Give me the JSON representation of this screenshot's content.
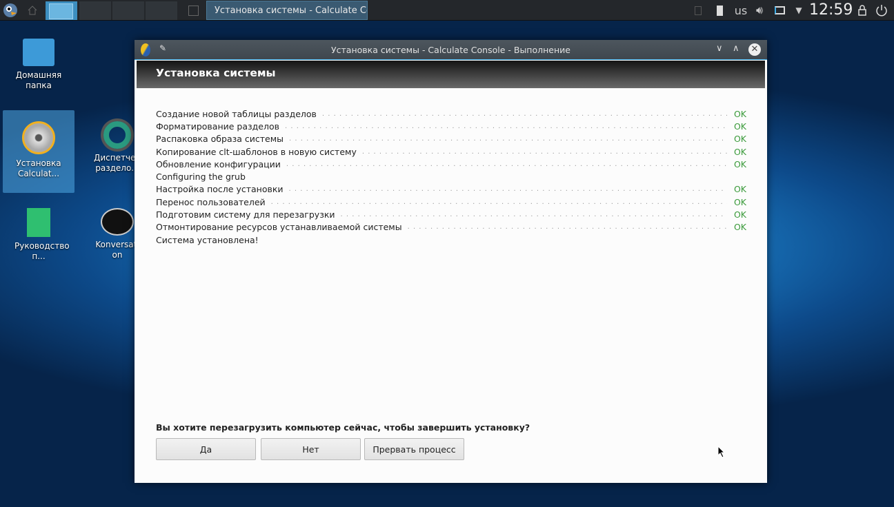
{
  "taskbar": {
    "task_title": "Установка системы - Calculate Console",
    "keyboard_layout": "us",
    "clock": "12:59"
  },
  "desktop": [
    {
      "label": "Домашняя папка",
      "icon": "home-folder-icon"
    },
    {
      "label": "Установка Calculat...",
      "icon": "calculate-install-icon",
      "selected": true
    },
    {
      "label": "Диспетчер раздело...",
      "icon": "partition-manager-icon"
    },
    {
      "label": "Руководство п...",
      "icon": "guide-icon"
    },
    {
      "label": "Konversation",
      "icon": "konversation-icon"
    }
  ],
  "window": {
    "title": "Установка системы - Calculate Console - Выполнение",
    "header": "Установка системы",
    "steps": [
      {
        "text": "Создание новой таблицы разделов",
        "status": "OK"
      },
      {
        "text": "Форматирование разделов",
        "status": "OK"
      },
      {
        "text": "Распаковка образа системы",
        "status": "OK"
      },
      {
        "text": "Копирование clt-шаблонов в новую систему",
        "status": "OK"
      },
      {
        "text": "Обновление конфигурации",
        "status": "OK"
      },
      {
        "text": "Configuring the grub",
        "status": ""
      },
      {
        "text": "Настройка после установки",
        "status": "OK"
      },
      {
        "text": "Перенос пользователей",
        "status": "OK"
      },
      {
        "text": "Подготовим систему для перезагрузки",
        "status": "OK"
      },
      {
        "text": "Отмонтирование ресурсов устанавливаемой системы",
        "status": "OK"
      },
      {
        "text": "Система установлена!",
        "status": ""
      }
    ],
    "question": "Вы хотите перезагрузить компьютер сейчас, чтобы завершить установку?",
    "buttons": {
      "yes": "Да",
      "no": "Нет",
      "abort": "Прервать процесс"
    }
  },
  "colors": {
    "ok": "#3a9a3a",
    "accent": "#3daee9"
  }
}
